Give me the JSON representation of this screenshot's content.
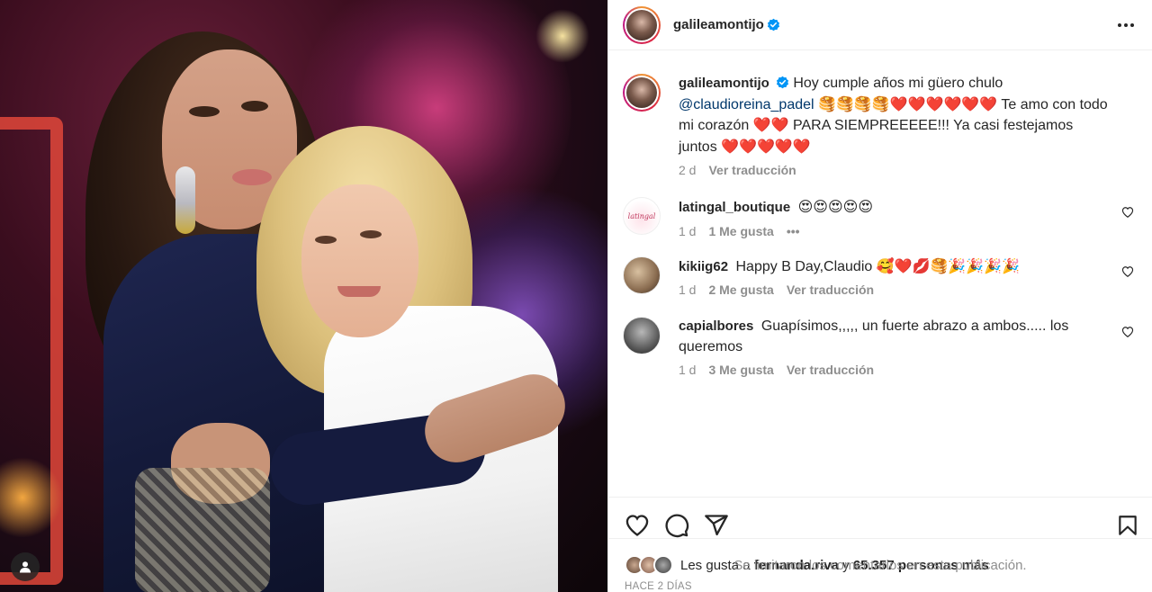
{
  "post": {
    "author": "galileamontijo",
    "caption": {
      "username": "galileamontijo",
      "text_before_mention": "Hoy cumple años mi güero chulo",
      "mention": "@claudioreina_padel",
      "emojis_1": "🥞🥞🥞🥞❤️❤️❤️❤️❤️❤️",
      "text_mid": "Te amo con todo mi corazón",
      "emojis_2": "❤️❤️",
      "text_after": "PARA SIEMPREEEEE!!! Ya casi festejamos juntos",
      "emojis_3": "❤️❤️❤️❤️❤️",
      "time": "2 d",
      "translate": "Ver traducción"
    },
    "comments": [
      {
        "username": "latingal_boutique",
        "text": "",
        "emojis": "😍😍😍😍😍",
        "avatar_text": "latingal",
        "time": "1 d",
        "likes": "1 Me gusta",
        "extra": "•••"
      },
      {
        "username": "kikiig62",
        "text": "Happy B Day,Claudio",
        "emojis": "🥰❤️💋🥞🎉🎉🎉🎉",
        "time": "1 d",
        "likes": "2 Me gusta",
        "extra": "Ver traducción"
      },
      {
        "username": "capialbores",
        "text": "Guapísimos,,,,, un fuerte abrazo a ambos..... los queremos",
        "emojis": "",
        "time": "1 d",
        "likes": "3 Me gusta",
        "extra": "Ver traducción"
      }
    ],
    "likes": {
      "prefix": "Les gusta a",
      "first_user": "fernanda.riva",
      "connector": "y",
      "others": "65.357 personas más"
    },
    "timestamp": "HACE 2 DÍAS",
    "footer": "Se limitaron los comentarios en esta publicación."
  },
  "icons": {
    "verified": "verified-badge-icon",
    "more": "more-options-icon",
    "like": "heart-icon",
    "comment": "comment-bubble-icon",
    "share": "paper-plane-icon",
    "save": "bookmark-icon",
    "tag": "user-tag-icon"
  },
  "colors": {
    "verified": "#0095f6",
    "mention": "#00376b",
    "muted": "#8e8e8e",
    "text": "#262626",
    "divider": "#efefef"
  }
}
